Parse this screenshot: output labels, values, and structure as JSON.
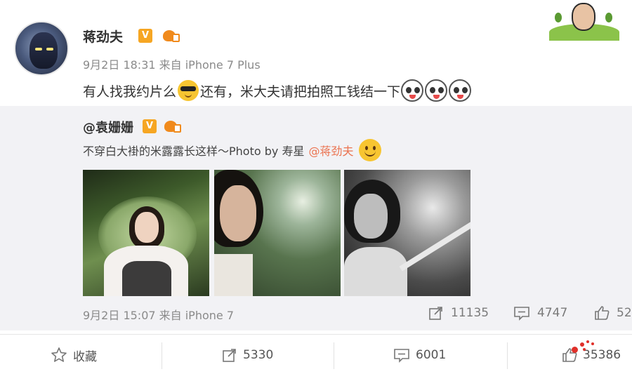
{
  "post": {
    "username": "蒋劲夫",
    "verified_badge": "V",
    "member_icon": "crown-vip-icon",
    "meta": "9月2日 18:31 来自 iPhone 7 Plus",
    "text_part1": "有人找我约片么",
    "text_part2": "还有，米大夫请把拍照工钱结一下",
    "emojis": [
      "sunglasses-emoji",
      "panda-emoji",
      "panda-emoji",
      "panda-emoji"
    ]
  },
  "repost": {
    "username": "@袁姗姗",
    "verified_badge": "V",
    "text": "不穿白大褂的米露露长这样～Photo by 寿星",
    "mention": "@蒋劲夫",
    "emoji": "smile-emoji",
    "meta": "9月2日 15:07 来自 iPhone 7",
    "stats": {
      "reposts": "11135",
      "comments": "4747",
      "likes": "52"
    }
  },
  "actions": {
    "favorite_label": "收藏",
    "repost_count": "5330",
    "comment_count": "6001",
    "like_count": "35386"
  },
  "colors": {
    "mention": "#eb7350",
    "repost_bg": "#f2f2f5",
    "verified": "#f6a623"
  }
}
